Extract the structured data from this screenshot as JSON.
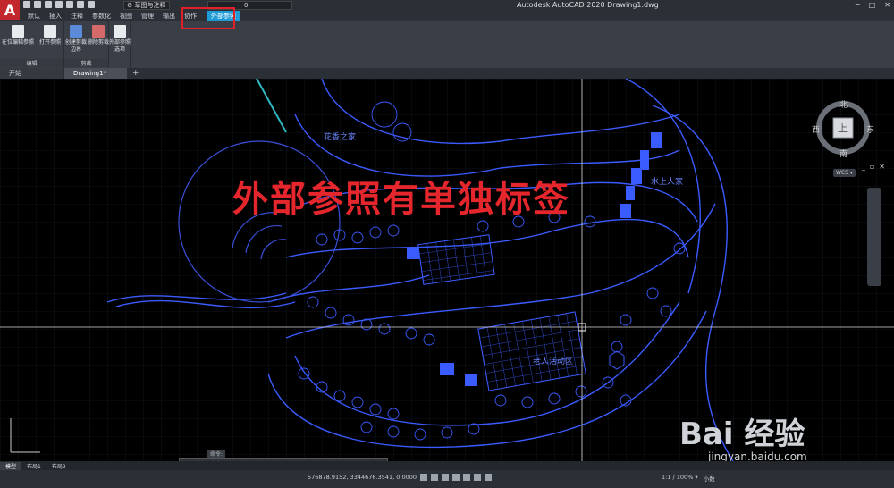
{
  "app": {
    "logo": "A",
    "title": "Autodesk AutoCAD 2020    Drawing1.dwg",
    "workspace": "⚙ 草图与注释",
    "layer_value": "0"
  },
  "ribbon_tabs": [
    "默认",
    "插入",
    "注释",
    "参数化",
    "视图",
    "管理",
    "输出",
    "协作"
  ],
  "active_tab": "外部参照",
  "ribbon": {
    "edit_panel": {
      "title": "编辑",
      "buttons": [
        "在位编辑参照",
        "打开参照"
      ]
    },
    "clip_panel": {
      "title": "剪裁",
      "buttons": [
        "创建剪裁边界",
        "删除剪裁"
      ]
    },
    "options_panel": {
      "title": "外部参照选项",
      "buttons": [
        "外部参照选项"
      ]
    }
  },
  "doc_tabs": [
    "开始",
    "Drawing1*"
  ],
  "plus": "+",
  "annotation": {
    "text": "外部参照有单独标签"
  },
  "plan_labels": {
    "label1": "花香之家",
    "label2": "水上人家",
    "label3": "老人活动区"
  },
  "viewcube": {
    "n": "北",
    "s": "南",
    "w": "西",
    "e": "东",
    "top": "上",
    "wcs": "WCS ▾"
  },
  "layout_tabs": [
    "模型",
    "布局1",
    "布局2"
  ],
  "command": {
    "placeholder": "键入命令",
    "history": "命令:"
  },
  "status": {
    "coords": "576878.9152, 3344676.3541, 0.0000",
    "model": "模型",
    "scale": "1:1 / 100% ▾",
    "units": "小数"
  },
  "watermark": {
    "text": "Bai 经验",
    "url": "jingyan.baidu.com"
  },
  "colors": {
    "accent": "#1f9bd6",
    "annotation": "#e5262d",
    "drawing": "#3b5bff"
  }
}
